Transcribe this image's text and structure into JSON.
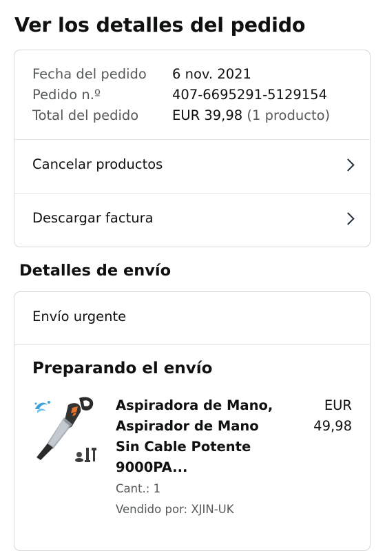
{
  "page": {
    "title": "Ver los detalles del pedido"
  },
  "order_summary": {
    "date_label": "Fecha del pedido",
    "date_value": "6 nov. 2021",
    "number_label": "Pedido n.º",
    "number_value": "407-6695291-5129154",
    "total_label": "Total del pedido",
    "total_value": "EUR 39,98",
    "total_items": "(1 producto)"
  },
  "actions": {
    "cancel_label": "Cancelar productos",
    "invoice_label": "Descargar factura"
  },
  "shipping": {
    "section_title": "Detalles de envío",
    "method": "Envío urgente",
    "status": "Preparando el envío",
    "item": {
      "title": "Aspiradora de Mano, Aspirador de Mano Sin Cable Potente 9000PA...",
      "price_currency": "EUR",
      "price_amount": "49,98",
      "quantity": "Cant.: 1",
      "seller": "Vendido por: XJIN-UK",
      "image_icon": "handheld-vacuum-icon"
    }
  },
  "colors": {
    "text": "#0f1111",
    "muted_text": "#565959",
    "border": "#d5d9d9",
    "chevron": "#232f3e"
  }
}
